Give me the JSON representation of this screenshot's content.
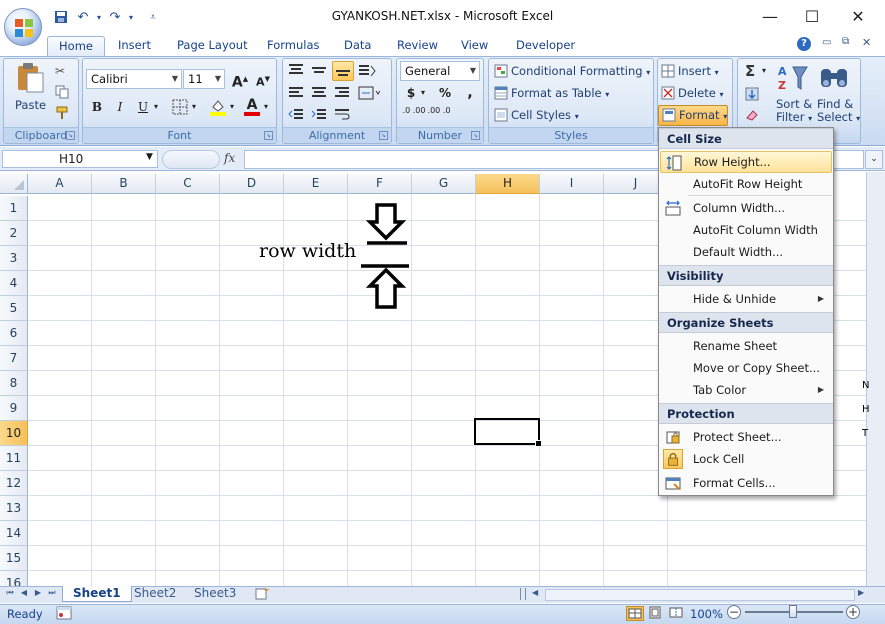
{
  "window": {
    "title": "GYANKOSH.NET.xlsx - Microsoft Excel",
    "minimize": "—",
    "maximize": "☐",
    "close": "✕"
  },
  "ribbon": {
    "tabs": [
      "Home",
      "Insert",
      "Page Layout",
      "Formulas",
      "Data",
      "Review",
      "View",
      "Developer"
    ],
    "active_tab": "Home",
    "help": "?",
    "groups": {
      "clipboard": {
        "label": "Clipboard",
        "paste": "Paste"
      },
      "font": {
        "label": "Font",
        "font_name": "Calibri",
        "font_size": "11",
        "grow": "A",
        "shrink": "A",
        "bold": "B",
        "italic": "I",
        "underline": "U"
      },
      "alignment": {
        "label": "Alignment"
      },
      "number": {
        "label": "Number",
        "format": "General",
        "currency": "$",
        "percent": "%",
        "comma": ",",
        "inc_dec": ".0 .00",
        "dec_dec": ".00 .0"
      },
      "styles": {
        "label": "Styles",
        "conditional": "Conditional Formatting",
        "format_table": "Format as Table",
        "cell_styles": "Cell Styles"
      },
      "cells": {
        "insert": "Insert",
        "delete": "Delete",
        "format": "Format"
      },
      "editing": {
        "sort": "Sort &",
        "sort2": "Filter",
        "find": "Find &",
        "find2": "Select",
        "sum": "Σ"
      }
    }
  },
  "formula_bar": {
    "name_box": "H10",
    "fx": "fx",
    "value": ""
  },
  "grid": {
    "columns": [
      "A",
      "B",
      "C",
      "D",
      "E",
      "F",
      "G",
      "H",
      "I",
      "J"
    ],
    "rows": [
      "1",
      "2",
      "3",
      "4",
      "5",
      "6",
      "7",
      "8",
      "9",
      "10",
      "11",
      "12",
      "13",
      "14",
      "15",
      "16"
    ],
    "selected_column": "H",
    "selected_row": "10",
    "annotation": "row width"
  },
  "right_fragments": [
    "N",
    "H",
    "T"
  ],
  "format_menu": {
    "sections": [
      {
        "title": "Cell Size",
        "items": [
          {
            "label": "Row Height...",
            "highlighted": true,
            "icon": "row-height-icon"
          },
          {
            "label": "AutoFit Row Height"
          },
          {
            "label": "Column Width...",
            "icon": "column-width-icon"
          },
          {
            "label": "AutoFit Column Width"
          },
          {
            "label": "Default Width..."
          }
        ]
      },
      {
        "title": "Visibility",
        "items": [
          {
            "label": "Hide & Unhide",
            "submenu": true
          }
        ]
      },
      {
        "title": "Organize Sheets",
        "items": [
          {
            "label": "Rename Sheet"
          },
          {
            "label": "Move or Copy Sheet..."
          },
          {
            "label": "Tab Color",
            "submenu": true
          }
        ]
      },
      {
        "title": "Protection",
        "items": [
          {
            "label": "Protect Sheet...",
            "icon": "protect-sheet-icon"
          },
          {
            "label": "Lock Cell",
            "icon": "lock-icon"
          },
          {
            "label": "Format Cells...",
            "icon": "format-cells-icon"
          }
        ]
      }
    ]
  },
  "sheets": [
    "Sheet1",
    "Sheet2",
    "Sheet3"
  ],
  "active_sheet": "Sheet1",
  "status": {
    "text": "Ready",
    "zoom": "100%",
    "minus": "−",
    "plus": "+"
  },
  "colors": {
    "accent": "#15428b",
    "selection": "#f6c05b",
    "ribbon": "#dde8f6"
  }
}
